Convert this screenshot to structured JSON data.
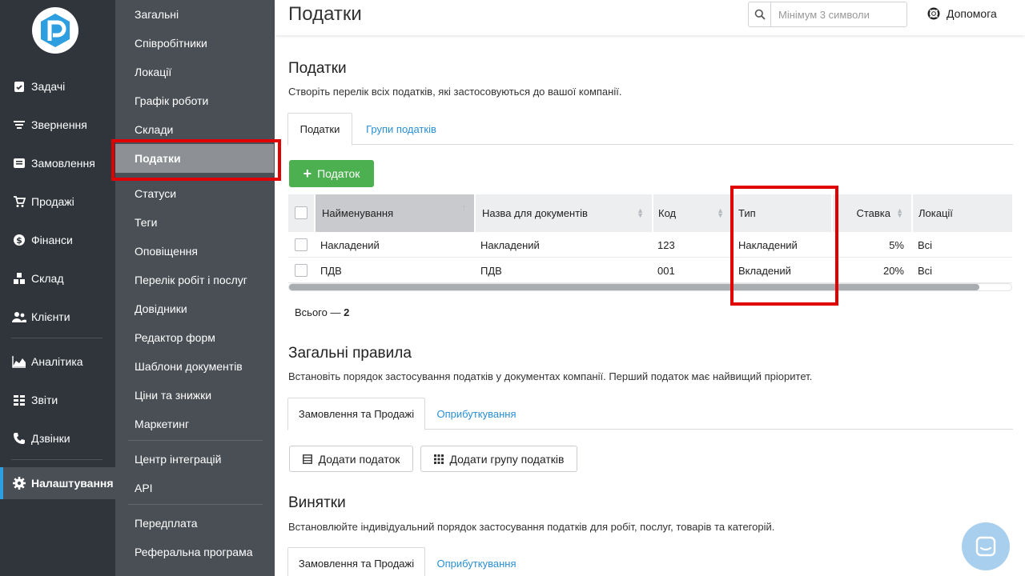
{
  "nav": {
    "items": [
      {
        "label": "Задачі",
        "icon": "clipboard-check-icon"
      },
      {
        "label": "Звернення",
        "icon": "filter-icon"
      },
      {
        "label": "Замовлення",
        "icon": "order-icon"
      },
      {
        "label": "Продажі",
        "icon": "cart-icon"
      },
      {
        "label": "Фінанси",
        "icon": "dollar-icon"
      },
      {
        "label": "Склад",
        "icon": "boxes-icon"
      },
      {
        "label": "Клієнти",
        "icon": "users-icon"
      },
      {
        "label": "Аналітика",
        "icon": "chart-area-icon"
      },
      {
        "label": "Звіти",
        "icon": "reports-icon"
      },
      {
        "label": "Дзвінки",
        "icon": "phone-icon"
      },
      {
        "label": "Налаштування",
        "icon": "gear-icon"
      }
    ],
    "active_index": 10
  },
  "submenu": {
    "items": [
      "Загальні",
      "Співробітники",
      "Локації",
      "Графік роботи",
      "Склади",
      "Податки",
      "Статуси",
      "Теги",
      "Оповіщення",
      "Перелік робіт і послуг",
      "Довідники",
      "Редактор форм",
      "Шаблони документів",
      "Ціни та знижки",
      "Маркетинг",
      "Центр інтеграцій",
      "API",
      "Передплата",
      "Реферальна програма"
    ],
    "active_label": "Податки"
  },
  "header": {
    "title": "Податки",
    "search_placeholder": "Мінімум 3 символи",
    "help_label": "Допомога"
  },
  "taxes_section": {
    "title": "Податки",
    "description": "Створіть перелік всіх податків, які застосовуються до вашої компанії.",
    "tabs": [
      "Податки",
      "Групи податків"
    ],
    "add_button": "Податок",
    "columns": [
      "Найменування",
      "Назва для документів",
      "Код",
      "Тип",
      "Ставка",
      "Локації"
    ],
    "rows": [
      {
        "name": "Накладений",
        "doc_name": "Накладений",
        "code": "123",
        "type": "Накладений",
        "rate": "5%",
        "locations": "Всі"
      },
      {
        "name": "ПДВ",
        "doc_name": "ПДВ",
        "code": "001",
        "type": "Вкладений",
        "rate": "20%",
        "locations": "Всі"
      }
    ],
    "total_label": "Всього —",
    "total_value": "2"
  },
  "rules_section": {
    "title": "Загальні правила",
    "description": "Встановіть порядок застосування податків у документах компанії. Перший податок має найвищий пріоритет.",
    "tabs": [
      "Замовлення та Продажі",
      "Оприбуткування"
    ],
    "add_tax_button": "Додати податок",
    "add_group_button": "Додати групу податків"
  },
  "exceptions_section": {
    "title": "Винятки",
    "description": "Встановлюйте індивідуальний порядок застосування податків для робіт, послуг, товарів та категорій.",
    "tabs": [
      "Замовлення та Продажі",
      "Оприбуткування"
    ]
  },
  "colors": {
    "nav_bg": "#2f353b",
    "submenu_bg": "#4a4f55",
    "accent": "#2d9ee0",
    "success": "#4caf50",
    "highlight": "#e00000"
  }
}
